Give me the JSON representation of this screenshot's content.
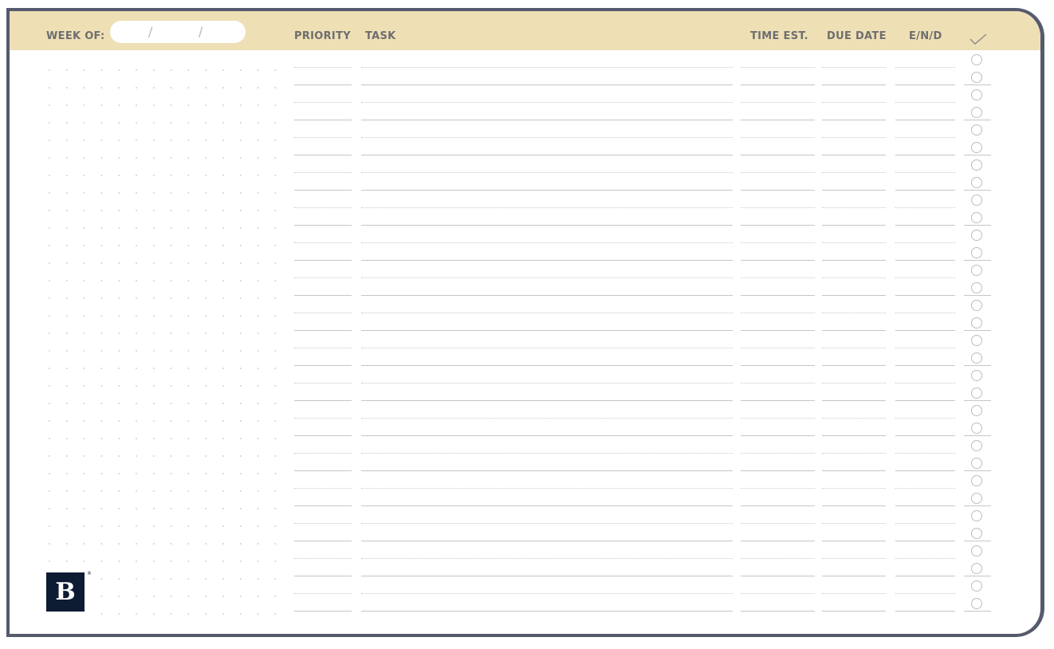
{
  "header": {
    "week_of_label": "WEEK OF:",
    "date_separator": "/",
    "columns": {
      "priority": "PRIORITY",
      "task": "TASK",
      "time_est": "TIME EST.",
      "due_date": "DUE DATE",
      "end": "E/N/D"
    },
    "done_column_icon": "checkmark-icon"
  },
  "logo": {
    "letter": "B",
    "registered_mark": "®"
  },
  "colors": {
    "header_background": "#eedfb5",
    "frame_border": "#555a6e",
    "label_text": "#6e6e6e",
    "logo_background": "#0d1b33"
  },
  "task_rows": 16,
  "dot_rows": 33,
  "dot_columns": 14
}
